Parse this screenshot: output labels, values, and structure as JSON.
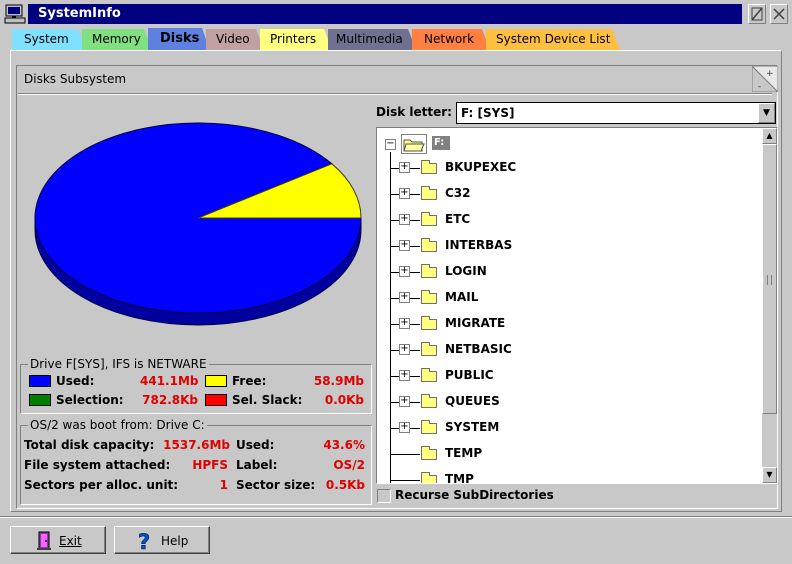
{
  "window": {
    "title": "SystemInfo"
  },
  "tabs": [
    {
      "label": "System",
      "color": "#80e0ff"
    },
    {
      "label": "Memory",
      "color": "#80e080"
    },
    {
      "label": "Disks",
      "color": "#6080e0",
      "active": true
    },
    {
      "label": "Video",
      "color": "#c0a0a0"
    },
    {
      "label": "Printers",
      "color": "#ffff80"
    },
    {
      "label": "Multimedia",
      "color": "#707090"
    },
    {
      "label": "Network",
      "color": "#ff8040"
    },
    {
      "label": "System Device List",
      "color": "#ffc040"
    }
  ],
  "page": {
    "subsystem_label": "Disks Subsystem"
  },
  "chart_data": {
    "type": "pie",
    "slices": [
      {
        "label": "Used",
        "value": 441.1,
        "color": "#0000ff"
      },
      {
        "label": "Free",
        "value": 58.9,
        "color": "#ffff00"
      }
    ]
  },
  "drive_group": {
    "title": "Drive F[SYS], IFS is NETWARE",
    "used_label": "Used:",
    "used_value": "441.1Mb",
    "used_color": "#0000ff",
    "free_label": "Free:",
    "free_value": "58.9Mb",
    "free_color": "#ffff00",
    "selection_label": "Selection:",
    "selection_value": "782.8Kb",
    "selection_color": "#008000",
    "slack_label": "Sel. Slack:",
    "slack_value": "0.0Kb",
    "slack_color": "#ff0000"
  },
  "boot_group": {
    "title": "OS/2 was boot from: Drive  C:",
    "capacity_label": "Total disk capacity:",
    "capacity_value": "1537.6Mb",
    "used_label": "Used:",
    "used_value": "43.6%",
    "fs_label": "File system attached:",
    "fs_value": "HPFS",
    "vol_label": "Label:",
    "vol_value": "OS/2",
    "sectors_label": "Sectors per alloc. unit:",
    "sectors_value": "1",
    "sector_size_label": "Sector size:",
    "sector_size_value": "0.5Kb"
  },
  "disk_letter": {
    "label": "Disk letter:",
    "value": "F: [SYS]"
  },
  "tree": {
    "root": "F:",
    "items": [
      {
        "name": "BKUPEXEC",
        "expandable": true
      },
      {
        "name": "C32",
        "expandable": true
      },
      {
        "name": "ETC",
        "expandable": true
      },
      {
        "name": "INTERBAS",
        "expandable": true
      },
      {
        "name": "LOGIN",
        "expandable": true
      },
      {
        "name": "MAIL",
        "expandable": true
      },
      {
        "name": "MIGRATE",
        "expandable": true
      },
      {
        "name": "NETBASIC",
        "expandable": true
      },
      {
        "name": "PUBLIC",
        "expandable": true
      },
      {
        "name": "QUEUES",
        "expandable": true
      },
      {
        "name": "SYSTEM",
        "expandable": true
      },
      {
        "name": "TEMP",
        "expandable": false
      },
      {
        "name": "TMP",
        "expandable": false
      }
    ]
  },
  "recurse": {
    "label": "Recurse SubDirectories",
    "checked": false
  },
  "buttons": {
    "exit": "Exit",
    "help": "Help"
  }
}
